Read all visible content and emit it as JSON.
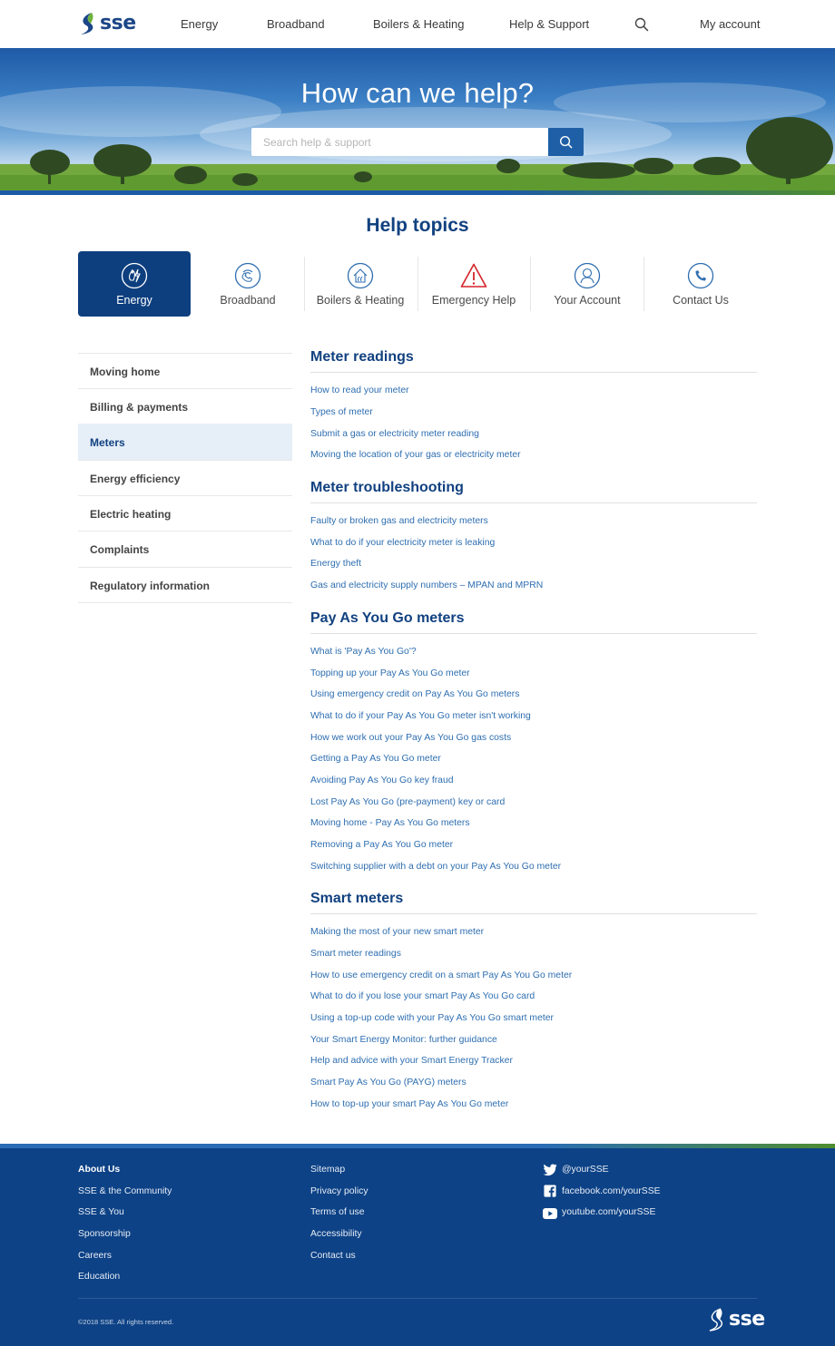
{
  "header": {
    "logo_text": "sse",
    "nav": [
      "Energy",
      "Broadband",
      "Boilers & Heating",
      "Help & Support"
    ],
    "account": "My account"
  },
  "hero": {
    "title": "How can we help?",
    "search_placeholder": "Search help & support"
  },
  "topics": {
    "title": "Help topics",
    "items": [
      {
        "label": "Energy",
        "icon": "energy-icon",
        "active": true
      },
      {
        "label": "Broadband",
        "icon": "broadband-icon"
      },
      {
        "label": "Boilers & Heating",
        "icon": "home-heating-icon"
      },
      {
        "label": "Emergency Help",
        "icon": "warning-icon"
      },
      {
        "label": "Your Account",
        "icon": "user-icon"
      },
      {
        "label": "Contact Us",
        "icon": "phone-icon"
      }
    ]
  },
  "sidebar": {
    "items": [
      "Moving home",
      "Billing & payments",
      "Meters",
      "Energy efficiency",
      "Electric heating",
      "Complaints",
      "Regulatory information"
    ],
    "active": "Meters"
  },
  "sections": [
    {
      "title": "Meter readings",
      "links": [
        "How to read your meter",
        "Types of meter",
        "Submit a gas or electricity meter reading",
        "Moving the location of your gas or electricity meter"
      ]
    },
    {
      "title": "Meter troubleshooting",
      "links": [
        "Faulty or broken gas and electricity meters",
        "What to do if your electricity meter is leaking",
        "Energy theft",
        "Gas and electricity supply numbers – MPAN and MPRN"
      ]
    },
    {
      "title": "Pay As You Go meters",
      "links": [
        "What is 'Pay As You Go'?",
        "Topping up your Pay As You Go meter",
        "Using emergency credit on Pay As You Go meters",
        "What to do if your Pay As You Go meter isn't working",
        "How we work out your Pay As You Go gas costs",
        "Getting a Pay As You Go meter",
        "Avoiding Pay As You Go key fraud",
        "Lost Pay As You Go (pre-payment) key or card",
        "Moving home - Pay As You Go meters",
        "Removing a Pay As You Go meter",
        "Switching supplier with a debt on your Pay As You Go meter"
      ]
    },
    {
      "title": "Smart meters",
      "links": [
        "Making the most of your new smart meter",
        "Smart meter readings",
        "How to use emergency credit on a smart Pay As You Go meter",
        "What to do if you lose your smart Pay As You Go card",
        "Using a top-up code with your Pay As You Go smart meter",
        "Your Smart Energy Monitor: further guidance",
        "Help and advice with your Smart Energy Tracker",
        "Smart Pay As You Go (PAYG) meters",
        "How to top-up your smart Pay As You Go meter"
      ]
    }
  ],
  "footer": {
    "col1": [
      "About Us",
      "SSE & the Community",
      "SSE & You",
      "Sponsorship",
      "Careers",
      "Education"
    ],
    "col2": [
      "Sitemap",
      "Privacy policy",
      "Terms of use",
      "Accessibility",
      "Contact us"
    ],
    "social": [
      {
        "label": "@yourSSE",
        "icon": "twitter-icon"
      },
      {
        "label": "facebook.com/yourSSE",
        "icon": "facebook-icon"
      },
      {
        "label": "youtube.com/yourSSE",
        "icon": "youtube-icon"
      }
    ],
    "copyright": "©2018 SSE. All rights reserved.",
    "logo_text": "sse"
  },
  "colors": {
    "brand_blue": "#0d4286",
    "link_blue": "#2e6eb0",
    "heading_blue": "#114180",
    "emergency_red": "#d3232a",
    "accent_green": "#4e8d2e"
  }
}
